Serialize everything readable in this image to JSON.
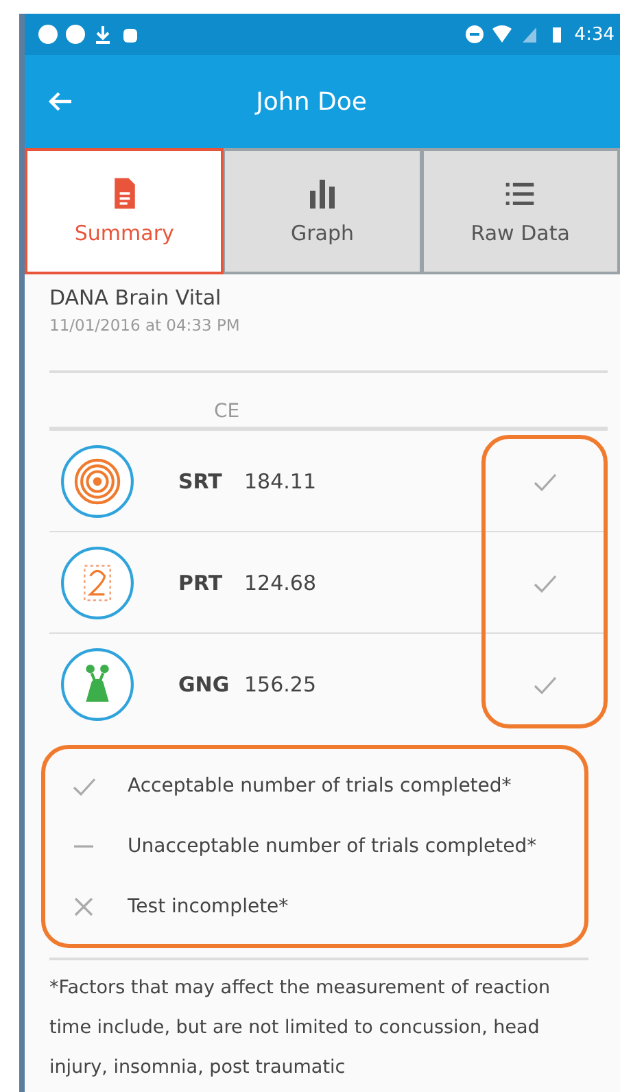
{
  "status_bar": {
    "time": "4:34"
  },
  "app_bar": {
    "title": "John Doe"
  },
  "tabs": [
    {
      "label": "Summary",
      "kind": "document",
      "selected": true
    },
    {
      "label": "Graph",
      "kind": "bars",
      "selected": false
    },
    {
      "label": "Raw Data",
      "kind": "list",
      "selected": false
    }
  ],
  "header": {
    "title": "DANA Brain Vital",
    "date": "11/01/2016 at 04:33 PM"
  },
  "table": {
    "column_header": "CE",
    "rows": [
      {
        "icon": {
          "kind": "target"
        },
        "code": "SRT",
        "value": "184.11",
        "kind": "acceptable"
      },
      {
        "icon": {
          "kind": "digit"
        },
        "code": "PRT",
        "value": "124.68",
        "kind": "acceptable"
      },
      {
        "icon": {
          "kind": "creature"
        },
        "code": "GNG",
        "value": "156.25",
        "kind": "acceptable"
      }
    ]
  },
  "legend": [
    {
      "kind": "acceptable",
      "label": "Acceptable number of trials completed*"
    },
    {
      "kind": "unacceptable",
      "label": "Unacceptable number of trials completed*"
    },
    {
      "kind": "incomplete",
      "label": "Test incomplete*"
    }
  ],
  "footnote": "*Factors that may affect the measurement of reaction time include, but are not limited to concussion, head injury, insomnia, post traumatic"
}
